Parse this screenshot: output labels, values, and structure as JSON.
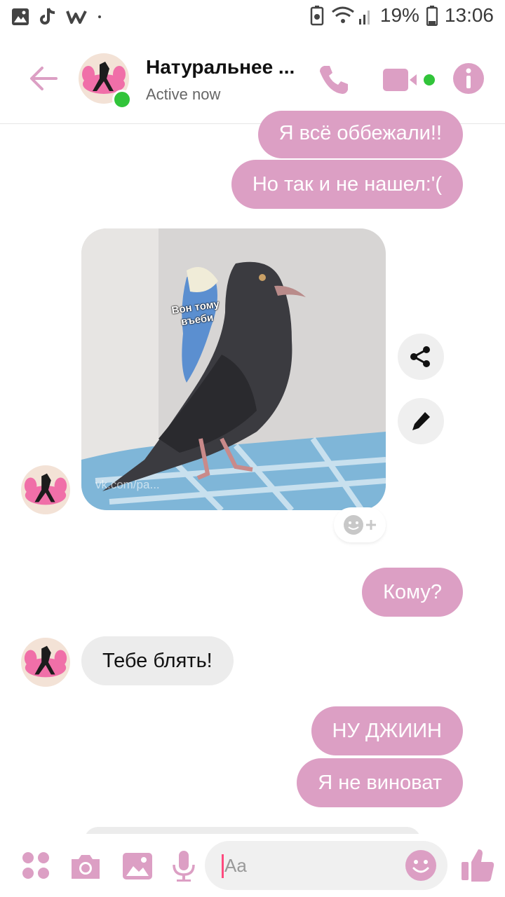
{
  "status_bar": {
    "battery": "19%",
    "time": "13:06"
  },
  "header": {
    "contact_name": "Натуральнее ...",
    "contact_status": "Active now"
  },
  "messages": [
    {
      "side": "out",
      "text": "Я всё оббежали!!"
    },
    {
      "side": "out",
      "text": "Но так и не нашел:'("
    },
    {
      "side": "in",
      "type": "photo",
      "caption": "Вон тому въеби",
      "watermark": "vk.com/pa..."
    },
    {
      "side": "out",
      "text": "Кому?"
    },
    {
      "side": "in",
      "text": "Тебе блять!"
    },
    {
      "side": "out",
      "text": "НУ ДЖИИН"
    },
    {
      "side": "out",
      "text": "Я не виноват"
    }
  ],
  "composer": {
    "placeholder": "Aa"
  },
  "colors": {
    "accent": "#dc9fc4",
    "incoming_bubble": "#ececec",
    "online": "#31c43a"
  }
}
